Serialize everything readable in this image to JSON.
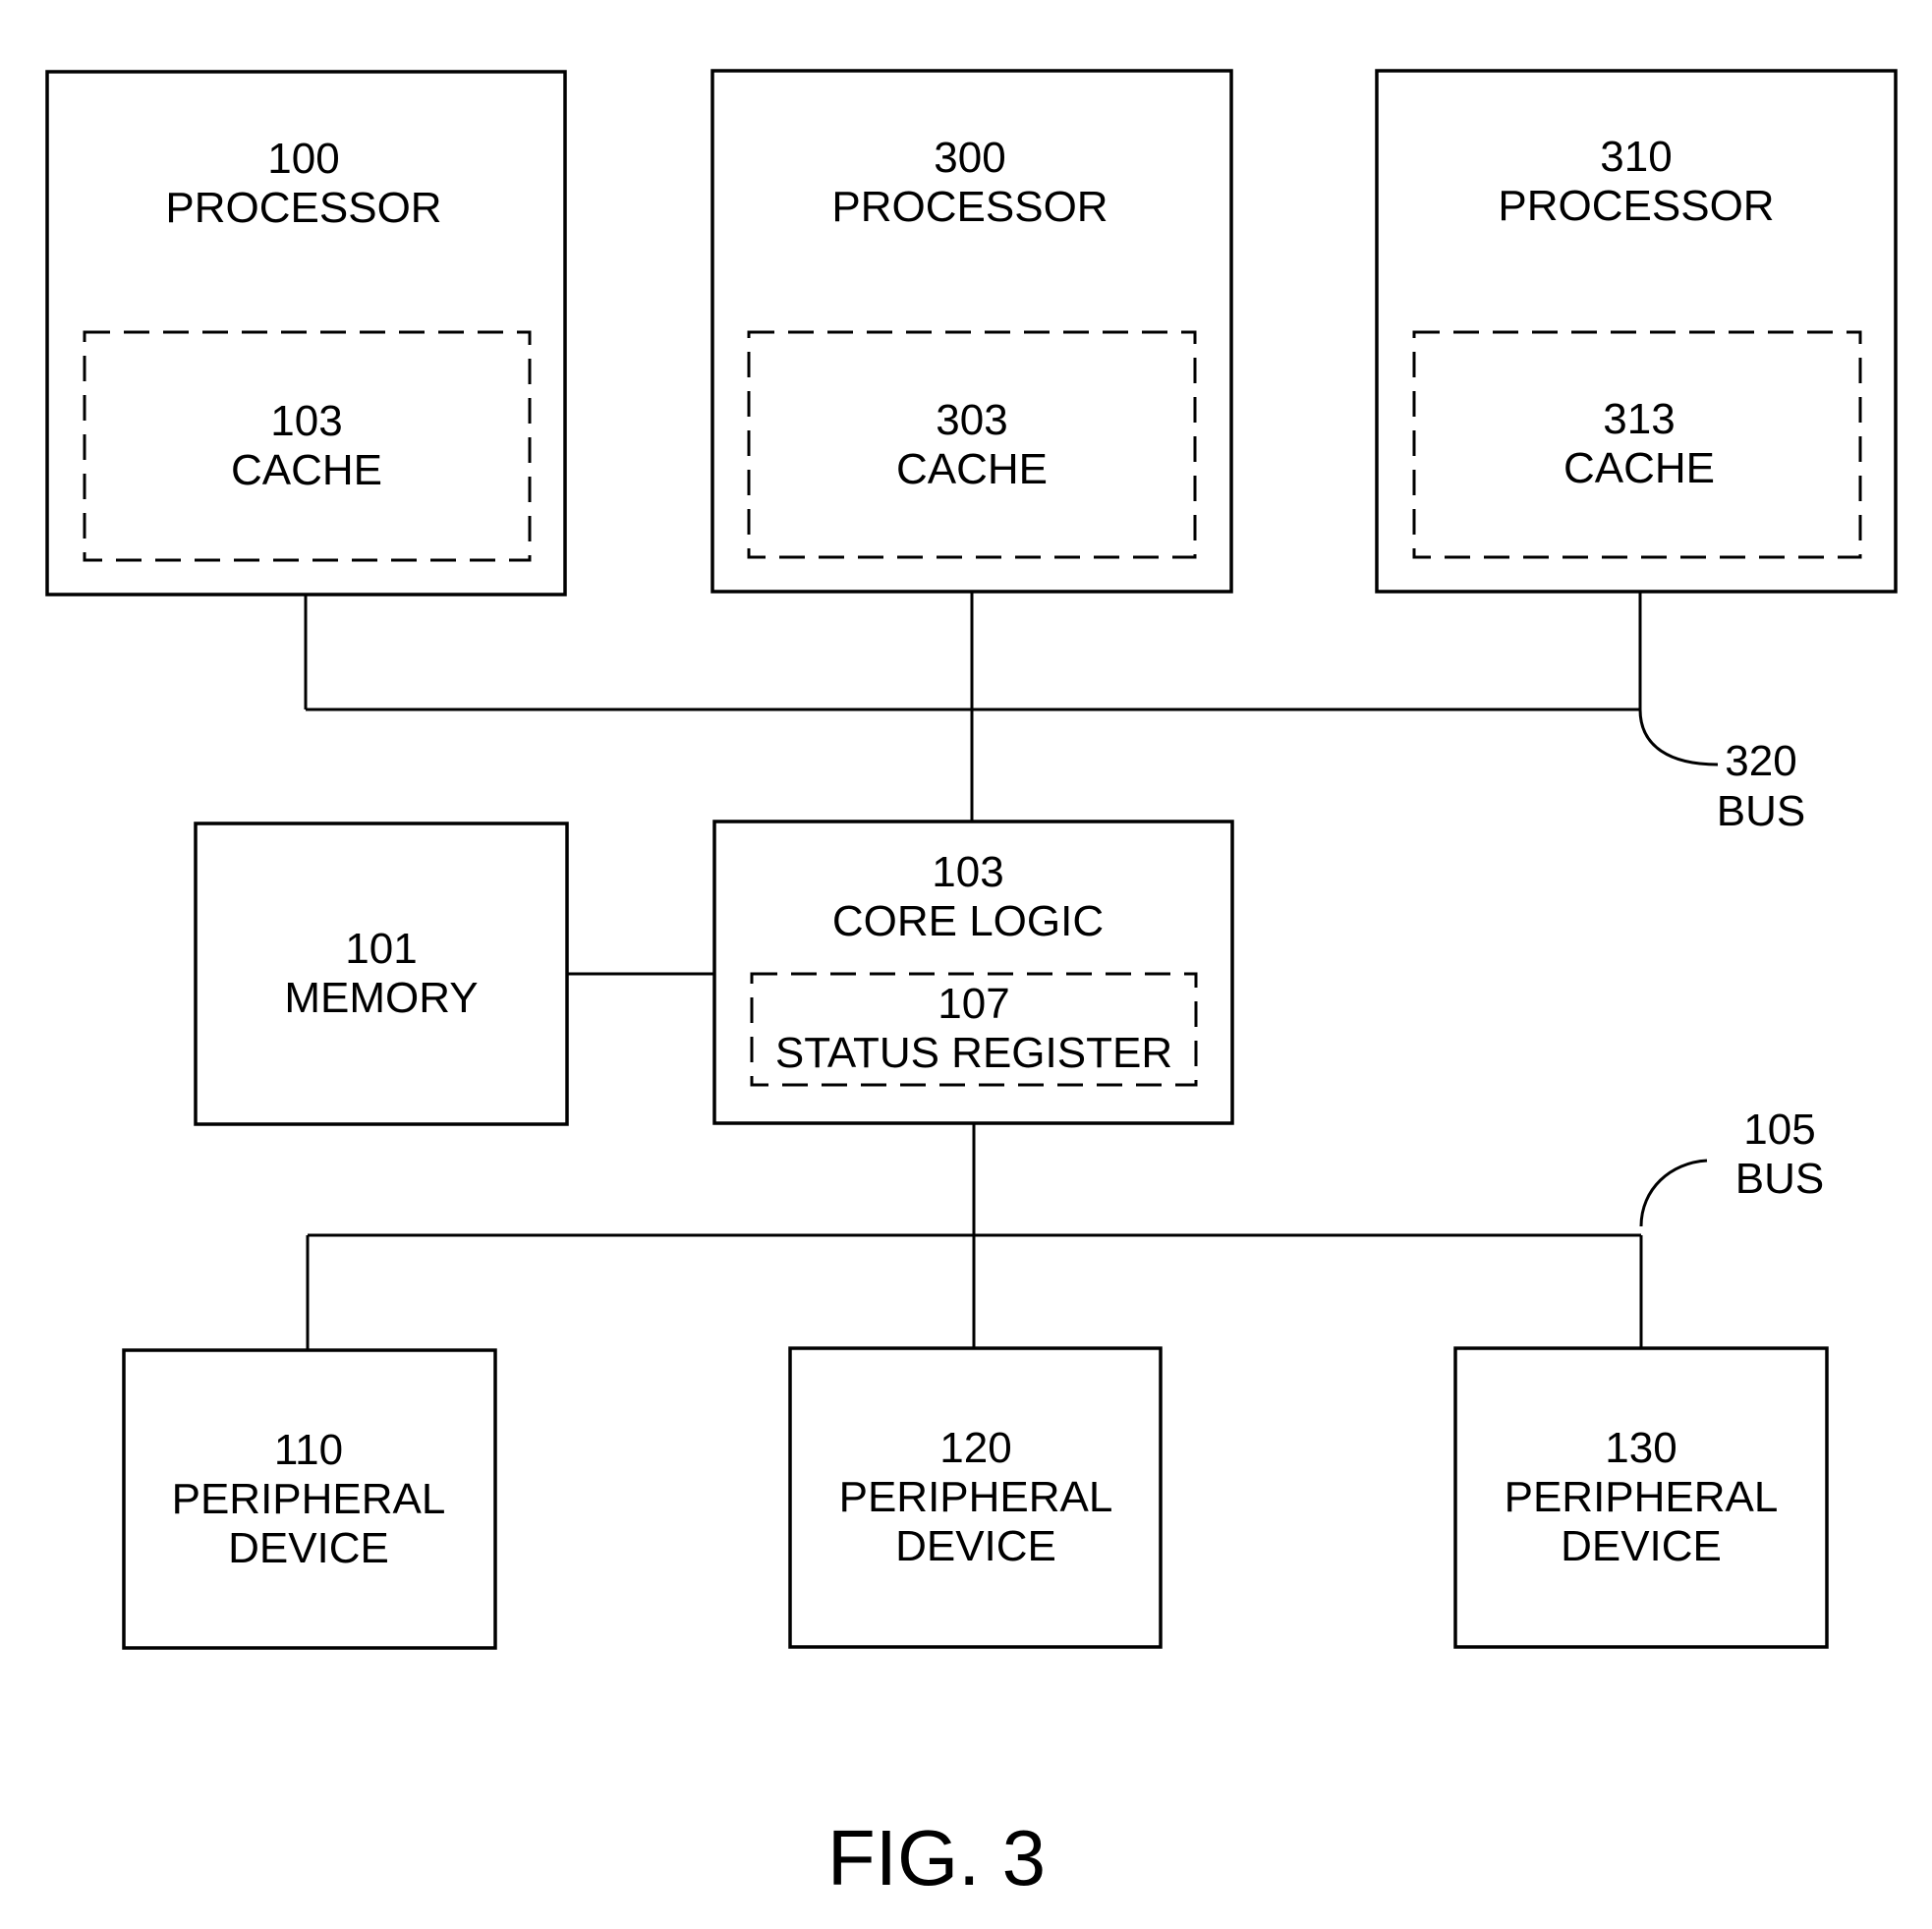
{
  "figure": {
    "caption": "FIG. 3",
    "processors": [
      {
        "ref": "100",
        "label": "PROCESSOR",
        "cache": {
          "ref": "103",
          "label": "CACHE"
        }
      },
      {
        "ref": "300",
        "label": "PROCESSOR",
        "cache": {
          "ref": "303",
          "label": "CACHE"
        }
      },
      {
        "ref": "310",
        "label": "PROCESSOR",
        "cache": {
          "ref": "313",
          "label": "CACHE"
        }
      }
    ],
    "memory": {
      "ref": "101",
      "label": "MEMORY"
    },
    "core_logic": {
      "ref": "103",
      "label": "CORE LOGIC",
      "status_register": {
        "ref": "107",
        "label": "STATUS REGISTER"
      }
    },
    "buses": [
      {
        "ref": "320",
        "label": "BUS"
      },
      {
        "ref": "105",
        "label": "BUS"
      }
    ],
    "peripherals": [
      {
        "ref": "110",
        "line1": "PERIPHERAL",
        "line2": "DEVICE"
      },
      {
        "ref": "120",
        "line1": "PERIPHERAL",
        "line2": "DEVICE"
      },
      {
        "ref": "130",
        "line1": "PERIPHERAL",
        "line2": "DEVICE"
      }
    ]
  }
}
